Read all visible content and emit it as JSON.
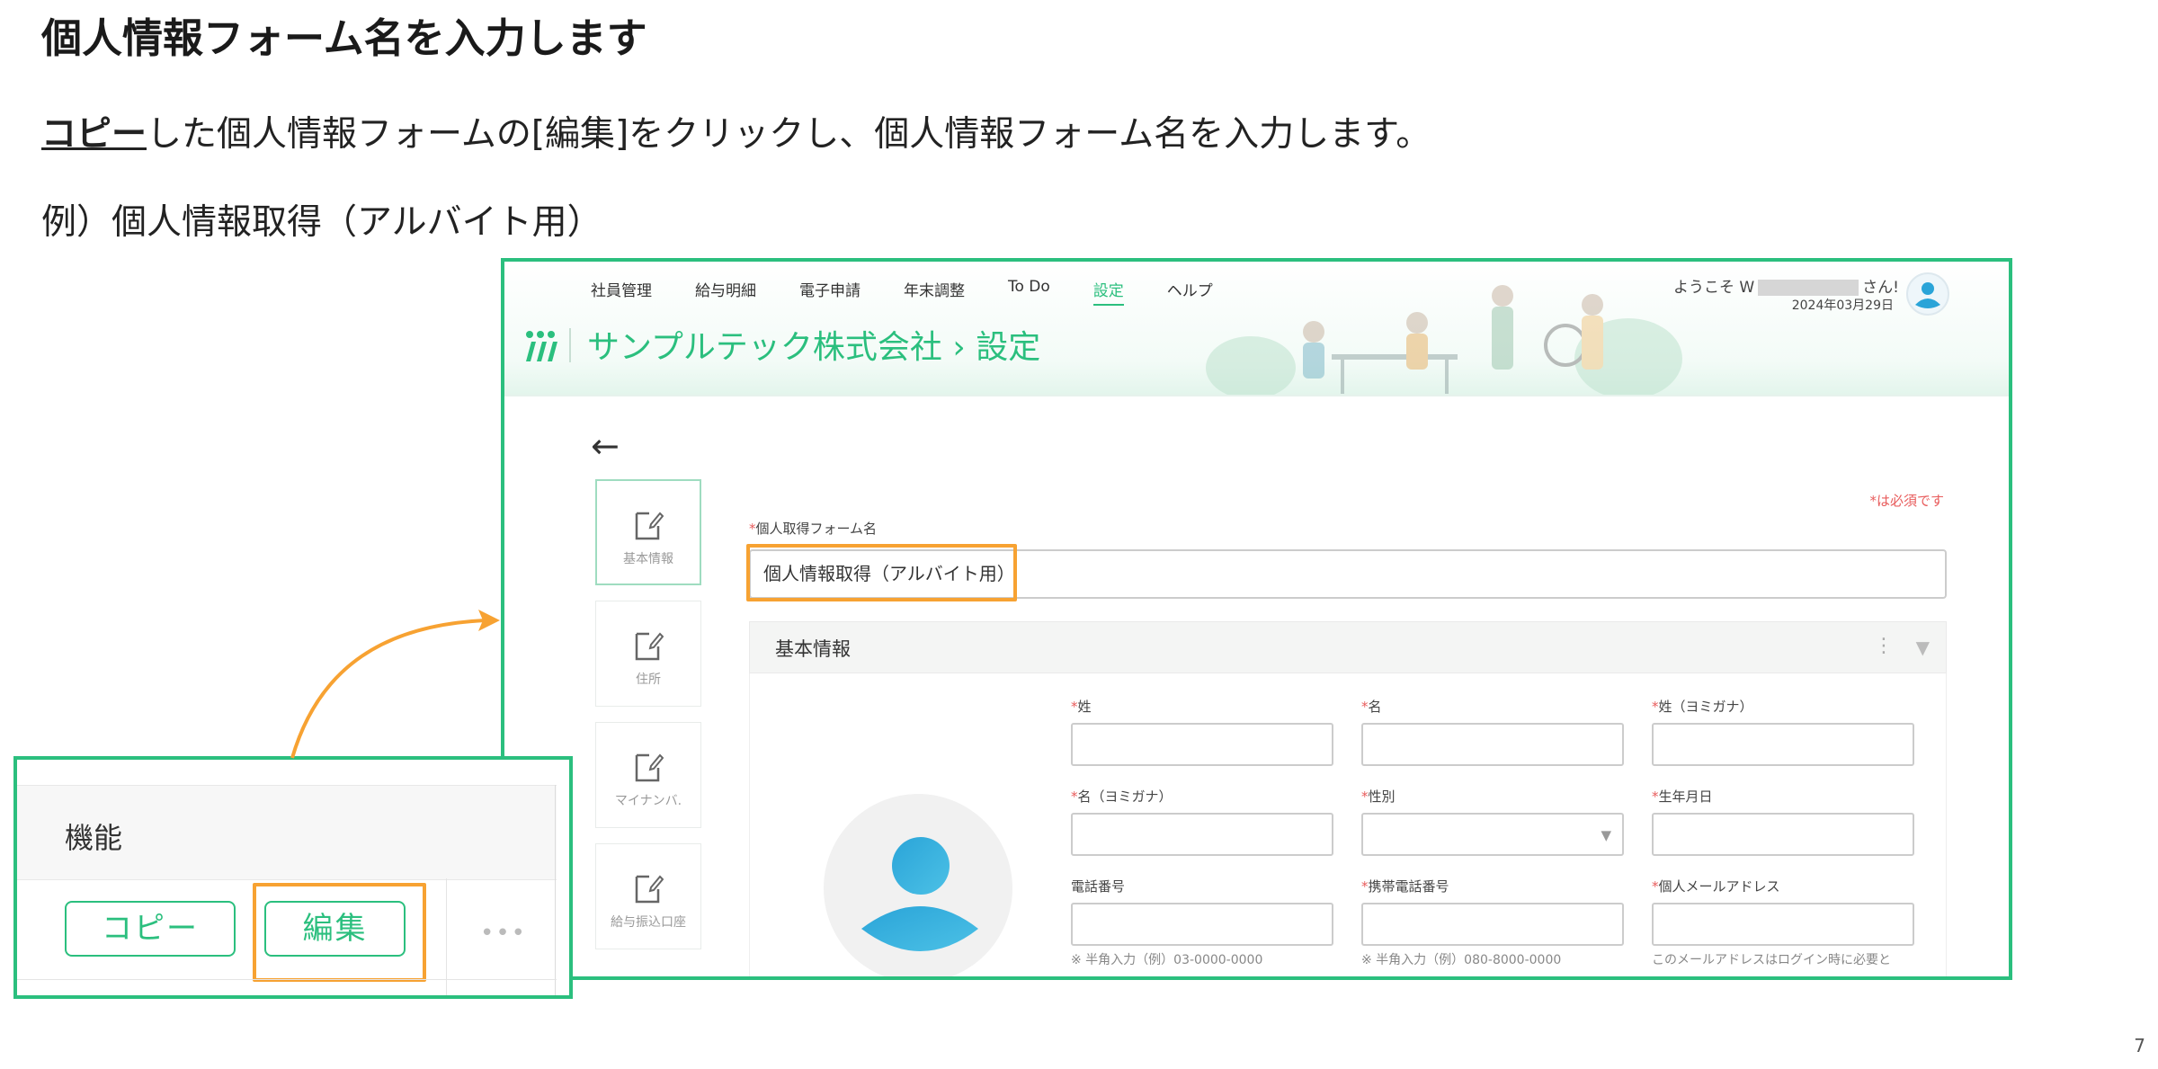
{
  "slide": {
    "title": "個人情報フォーム名を入力します",
    "instruction_link": "コピー",
    "instruction_rest": "した個人情報フォームの[編集]をクリックし、個人情報フォーム名を入力します。",
    "example": "例）個人情報取得（アルバイト用）",
    "page_number": "7"
  },
  "app": {
    "nav": [
      "社員管理",
      "給与明細",
      "電子申請",
      "年末調整",
      "To Do",
      "設定",
      "ヘルプ"
    ],
    "active_nav": "設定",
    "company_title": "サンプルテック株式会社 › 設定",
    "welcome_prefix": "ようこそ W",
    "welcome_suffix": "さん!",
    "date": "2024年03月29日",
    "required_note": "*は必須です",
    "sidebar_tabs": [
      "基本情報",
      "住所",
      "マイナンバ.",
      "給与振込口座"
    ],
    "form_name": {
      "label": "個人取得フォーム名",
      "value": "個人情報取得（アルバイト用）"
    },
    "section": {
      "title": "基本情報",
      "fields": [
        {
          "label": "姓",
          "required": true
        },
        {
          "label": "名",
          "required": true
        },
        {
          "label": "姓（ヨミガナ）",
          "required": true
        },
        {
          "label": "名（ヨミガナ）",
          "required": true
        },
        {
          "label": "性別",
          "required": true
        },
        {
          "label": "生年月日",
          "required": true
        },
        {
          "label": "電話番号",
          "required": false
        },
        {
          "label": "携帯電話番号",
          "required": true
        },
        {
          "label": "個人メールアドレス",
          "required": true
        }
      ],
      "hints": [
        "※ 半角入力（例）03-0000-0000",
        "※ 半角入力（例）080-8000-0000",
        "このメールアドレスはログイン時に必要と"
      ]
    }
  },
  "inset": {
    "header": "機能",
    "copy_button": "コピー",
    "edit_button": "編集",
    "more": "•••"
  },
  "colors": {
    "accent": "#2bbf7e",
    "highlight": "#f7a232",
    "required": "#e85c5c"
  }
}
